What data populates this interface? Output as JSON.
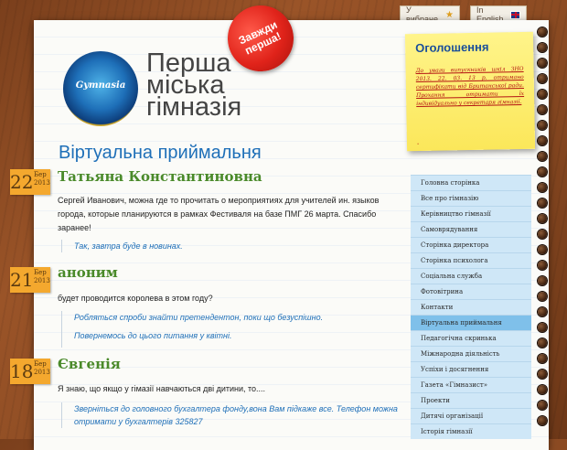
{
  "top_links": {
    "favorites": "У вибране",
    "english": "In English"
  },
  "site": {
    "title_lines": [
      "Перша",
      "міська",
      "гімназія"
    ],
    "logo_text": "Gymnasia"
  },
  "sticker": {
    "lines": [
      "Завжди",
      "перша!"
    ]
  },
  "announcement": {
    "title": "Оголошення",
    "body": "До уваги випускників шкіл ЗНО 2013. 22. 03. 13 р. отримано сертифікати від Британської ради. Прохання отримати їх індивідуально у секретаря гімназії.",
    "dash": "-"
  },
  "page": {
    "heading": "Віртуальна приймальня"
  },
  "entries": [
    {
      "day": "22",
      "month": "Бер",
      "year": "2013",
      "name": "Татьяна Константиновна",
      "question": "Сергей Иванович, можна где то прочитать о мероприятиях для учителей ин. языков города, которые планируются в рамках Фестиваля на базе ПМГ 26 марта. Спасибо заранее!",
      "answers": [
        "Так, завтра буде в новинах."
      ]
    },
    {
      "day": "21",
      "month": "Бер",
      "year": "2013",
      "name": "аноним",
      "question": "будет проводится королева в этом году?",
      "answers": [
        "Робляться спроби знайти претендентон, поки що безуспішно.",
        "Повернемось до цього питання у квітні."
      ]
    },
    {
      "day": "18",
      "month": "Бер",
      "year": "2013",
      "name": "Євгенія",
      "question": "Я знаю, що якщо у гімазії навчаються дві дитини, то....",
      "answers": [
        "Зверніться до головного бухгалтера фонду,вона Вам підкаже все. Телефон можна отримати у бухгалтерів 325827"
      ]
    }
  ],
  "menu": {
    "items": [
      "Головна сторінка",
      "Все про гімназію",
      "Керівництво гімназії",
      "Самоврядування",
      "Сторінка директора",
      "Сторінка психолога",
      "Соціальна служба",
      "Фотовітрина",
      "Контакти",
      "Віртуальна приймальня",
      "Педагогічна скринька",
      "Міжнародна діяльність",
      "Успіхи і досягнення",
      "Газета «Гімназист»",
      "Проекти",
      "Дитячі організації",
      "Історія гімназії"
    ],
    "active_index": 9
  }
}
